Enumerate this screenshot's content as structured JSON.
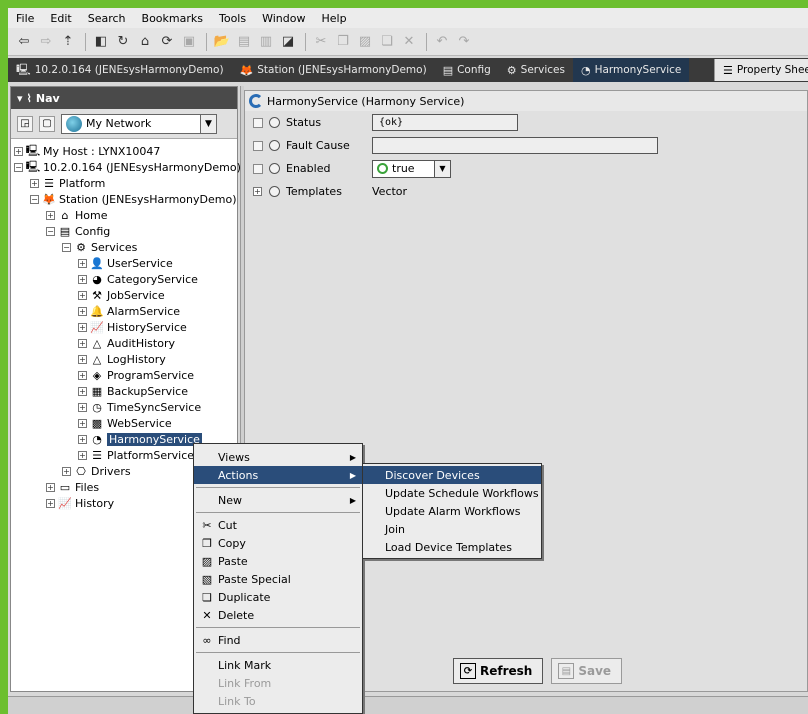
{
  "menubar": [
    "File",
    "Edit",
    "Search",
    "Bookmarks",
    "Tools",
    "Window",
    "Help"
  ],
  "locator": [
    {
      "icon": "host-icon",
      "glyph": "🖳",
      "label": "10.2.0.164 (JENEsysHarmonyDemo)"
    },
    {
      "icon": "station-icon",
      "glyph": "🦊",
      "label": "Station (JENEsysHarmonyDemo)"
    },
    {
      "icon": "config-icon",
      "glyph": "▤",
      "label": "Config"
    },
    {
      "icon": "services-icon",
      "glyph": "⚙",
      "label": "Services"
    },
    {
      "icon": "harmony-service-icon",
      "glyph": "◔",
      "label": "HarmonyService"
    }
  ],
  "property_sheet_tab": "Property Sheet",
  "nav": {
    "title": "Nav",
    "network": "My Network",
    "tree": [
      {
        "label": "My Host : LYNX10047",
        "icon": "host-icon",
        "glyph": "🖳",
        "exp": "+"
      },
      {
        "label": "10.2.0.164 (JENEsysHarmonyDemo)",
        "icon": "host-icon",
        "glyph": "🖳",
        "exp": "−"
      },
      {
        "label": "Platform",
        "icon": "platform-icon",
        "glyph": "☰",
        "exp": "+"
      },
      {
        "label": "Station (JENEsysHarmonyDemo)",
        "icon": "station-icon",
        "glyph": "🦊",
        "exp": "−"
      },
      {
        "label": "Home",
        "icon": "home-icon",
        "glyph": "⌂",
        "exp": "+"
      },
      {
        "label": "Config",
        "icon": "config-icon",
        "glyph": "▤",
        "exp": "−"
      },
      {
        "label": "Services",
        "icon": "services-icon",
        "glyph": "⚙",
        "exp": "−"
      },
      {
        "label": "UserService",
        "icon": "user-icon",
        "glyph": "👤",
        "exp": "+"
      },
      {
        "label": "CategoryService",
        "icon": "category-icon",
        "glyph": "◕",
        "exp": "+"
      },
      {
        "label": "JobService",
        "icon": "job-icon",
        "glyph": "⚒",
        "exp": "+"
      },
      {
        "label": "AlarmService",
        "icon": "alarm-icon",
        "glyph": "🔔",
        "exp": "+"
      },
      {
        "label": "HistoryService",
        "icon": "history-icon",
        "glyph": "📈",
        "exp": "+"
      },
      {
        "label": "AuditHistory",
        "icon": "audit-icon",
        "glyph": "△",
        "exp": "+"
      },
      {
        "label": "LogHistory",
        "icon": "log-icon",
        "glyph": "△",
        "exp": "+"
      },
      {
        "label": "ProgramService",
        "icon": "program-icon",
        "glyph": "◈",
        "exp": "+"
      },
      {
        "label": "BackupService",
        "icon": "backup-icon",
        "glyph": "▦",
        "exp": "+"
      },
      {
        "label": "TimeSyncService",
        "icon": "clock-icon",
        "glyph": "◷",
        "exp": "+"
      },
      {
        "label": "WebService",
        "icon": "web-icon",
        "glyph": "▩",
        "exp": "+"
      },
      {
        "label": "HarmonyService",
        "icon": "harmony-service-icon",
        "glyph": "◔",
        "exp": "+"
      },
      {
        "label": "PlatformServices",
        "icon": "platform-icon",
        "glyph": "☰",
        "exp": "+"
      },
      {
        "label": "Drivers",
        "icon": "drivers-icon",
        "glyph": "⎔",
        "exp": "+"
      },
      {
        "label": "Files",
        "icon": "files-icon",
        "glyph": "▭",
        "exp": "+"
      },
      {
        "label": "History",
        "icon": "history-icon",
        "glyph": "📈",
        "exp": "+"
      }
    ]
  },
  "sheet": {
    "header": "HarmonyService  (Harmony Service)",
    "status_label": "Status",
    "status_value": "{ok}",
    "fault_label": "Fault Cause",
    "fault_value": "",
    "enabled_label": "Enabled",
    "enabled_value": "true",
    "templates_label": "Templates",
    "templates_value": "Vector",
    "refresh": "Refresh",
    "save": "Save"
  },
  "context_menu": {
    "views": "Views",
    "actions": "Actions",
    "new": "New",
    "cut": "Cut",
    "copy": "Copy",
    "paste": "Paste",
    "paste_special": "Paste Special",
    "duplicate": "Duplicate",
    "delete": "Delete",
    "find": "Find",
    "link_mark": "Link Mark",
    "link_from": "Link From",
    "link_to": "Link To"
  },
  "actions_menu": [
    "Discover Devices",
    "Update Schedule Workflows",
    "Update Alarm Workflows",
    "Join",
    "Load Device Templates"
  ],
  "colors": {
    "accent": "#2a4d7a",
    "frame": "#6cbf2f"
  }
}
